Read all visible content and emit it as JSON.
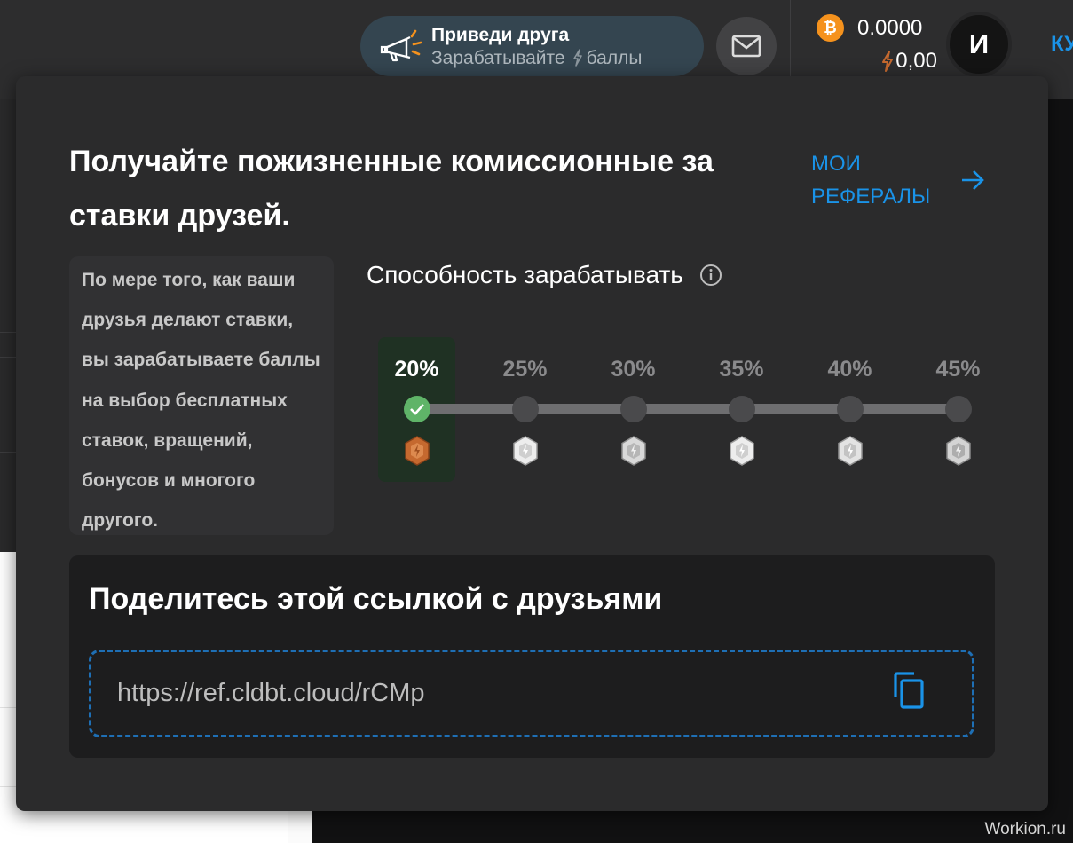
{
  "header": {
    "promo": {
      "title": "Приведи друга",
      "subtitle_prefix": "Зарабатывайте",
      "subtitle_suffix": "баллы"
    },
    "balance": {
      "crypto_symbol": "₿",
      "crypto_amount": "0.0000",
      "points": "0,00"
    },
    "avatar_letter": "И",
    "buy_label": "КУ"
  },
  "referral": {
    "headline": "Получайте пожизненные комиссионные за ставки друзей.",
    "my_referrals": "МОИ РЕФЕРАЛЫ",
    "description": "По мере того, как ваши друзья делают ставки, вы зарабатываете баллы на выбор бесплатных ставок, вращений, бонусов и многого другого.",
    "earn_title": "Способность зарабатывать",
    "tiers": [
      {
        "pct": "20%",
        "active": true,
        "badge": "bronze"
      },
      {
        "pct": "25%",
        "active": false,
        "badge": "silver"
      },
      {
        "pct": "30%",
        "active": false,
        "badge": "silver"
      },
      {
        "pct": "35%",
        "active": false,
        "badge": "silver"
      },
      {
        "pct": "40%",
        "active": false,
        "badge": "silver"
      },
      {
        "pct": "45%",
        "active": false,
        "badge": "silver"
      }
    ],
    "share_title": "Поделитесь этой ссылкой с друзьями",
    "share_link": "https://ref.cldbt.cloud/rCMp"
  },
  "colors": {
    "accent": "#1a93e8",
    "success": "#5fb468",
    "bitcoin": "#f5921d",
    "bronze": "#c5692f"
  },
  "watermark": "Workion.ru"
}
